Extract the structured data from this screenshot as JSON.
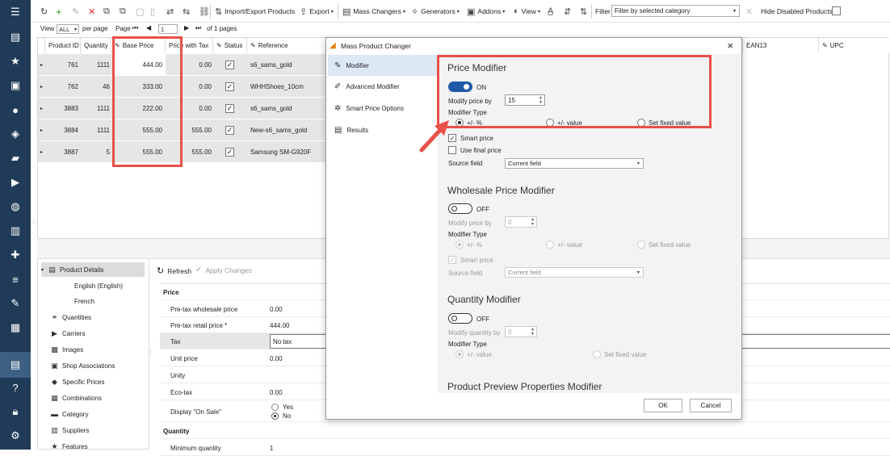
{
  "rail": {
    "items": [
      "hamburger",
      "store",
      "star",
      "shop",
      "user",
      "basket",
      "chat",
      "truck",
      "globe",
      "bar-chart",
      "puzzle",
      "sliders",
      "wrench",
      "report",
      "store-selected",
      "help",
      "lock",
      "gear"
    ]
  },
  "toolbar": {
    "import_export": "Import/Export Products",
    "export": "Export",
    "mass_changers": "Mass Changers",
    "generators": "Generators",
    "addons": "Addons",
    "view": "View",
    "filter_label": "Filter",
    "filter_value": "Filter by selected category",
    "hide_disabled": "Hide Disabled Products"
  },
  "pager": {
    "view_label": "View",
    "view_value": "ALL",
    "per_page": "per page",
    "page_label": "Page",
    "page_value": "1",
    "of_pages": "of 1 pages"
  },
  "grid": {
    "headers": [
      "Product ID",
      "Quantity",
      "Base Price",
      "Price with Tax",
      "Status",
      "Reference",
      "EAN13",
      "UPC"
    ],
    "rows": [
      {
        "id": "761",
        "qty": "1111",
        "price": "444.00",
        "tax_price": "0.00",
        "ref": "s6_sams_gold"
      },
      {
        "id": "762",
        "qty": "46",
        "price": "333.00",
        "tax_price": "0.00",
        "ref": "WHHShoes_10cm"
      },
      {
        "id": "3883",
        "qty": "1111",
        "price": "222.00",
        "tax_price": "0.00",
        "ref": "s6_sams_gold"
      },
      {
        "id": "3884",
        "qty": "1111",
        "price": "555.00",
        "tax_price": "555.00",
        "ref": "New-s6_sams_gold"
      },
      {
        "id": "3887",
        "qty": "5",
        "price": "555.00",
        "tax_price": "555.00",
        "ref": "Samsung SM-G920F"
      }
    ]
  },
  "tree": {
    "product_details": "Product Details",
    "items": [
      "English (English)",
      "French",
      "Quantities",
      "Carriers",
      "Images",
      "Shop Associations",
      "Specific Prices",
      "Combinations",
      "Category",
      "Suppliers",
      "Features"
    ]
  },
  "details": {
    "refresh": "Refresh",
    "apply": "Apply Changes",
    "section_price": "Price",
    "rows": [
      {
        "label": "Pre-tax wholesale price",
        "value": "0.00"
      },
      {
        "label": "Pre-tax retail price *",
        "value": "444.00"
      },
      {
        "label": "Tax",
        "value": "No tax"
      },
      {
        "label": "Unit price",
        "value": "0.00"
      },
      {
        "label": "Unity",
        "value": ""
      },
      {
        "label": "Eco-tax",
        "value": "0.00"
      },
      {
        "label": "Display \"On Sale\"",
        "value": ""
      }
    ],
    "yes": "Yes",
    "no": "No",
    "section_quantity": "Quantity",
    "min_qty_label": "Minimum quantity",
    "min_qty_value": "1"
  },
  "dialog": {
    "title": "Mass Product Changer",
    "close": "×",
    "side": [
      "Modifier",
      "Advanced Modifier",
      "Smart Price Options",
      "Results"
    ],
    "price": {
      "heading": "Price Modifier",
      "toggle": "ON",
      "modify_by": "Modify price by",
      "value": "15",
      "type_label": "Modifier Type",
      "opt1": "+/- %",
      "opt2": "+/- value",
      "opt3": "Set fixed value",
      "smart": "Smart price",
      "final": "Use final price",
      "source_label": "Source field",
      "source_value": "Current field"
    },
    "wholesale": {
      "heading": "Wholesale Price Modifier",
      "toggle": "OFF",
      "modify_by": "Modify price by",
      "value": "0",
      "type_label": "Modifier Type",
      "opt1": "+/- %",
      "opt2": "+/- value",
      "opt3": "Set fixed value",
      "smart": "Smart price",
      "source_label": "Source field",
      "source_value": "Current field"
    },
    "quantity": {
      "heading": "Quantity Modifier",
      "toggle": "OFF",
      "modify_by": "Modify quantity by",
      "value": "0",
      "type_label": "Modifier Type",
      "opt1": "+/- value",
      "opt2": "Set fixed value"
    },
    "preview_heading": "Product Preview Properties Modifier",
    "ok": "OK",
    "cancel": "Cancel"
  },
  "colors": {
    "rail": "#1f3b57",
    "accent": "#1e5aa8",
    "highlight": "#e8504a"
  }
}
